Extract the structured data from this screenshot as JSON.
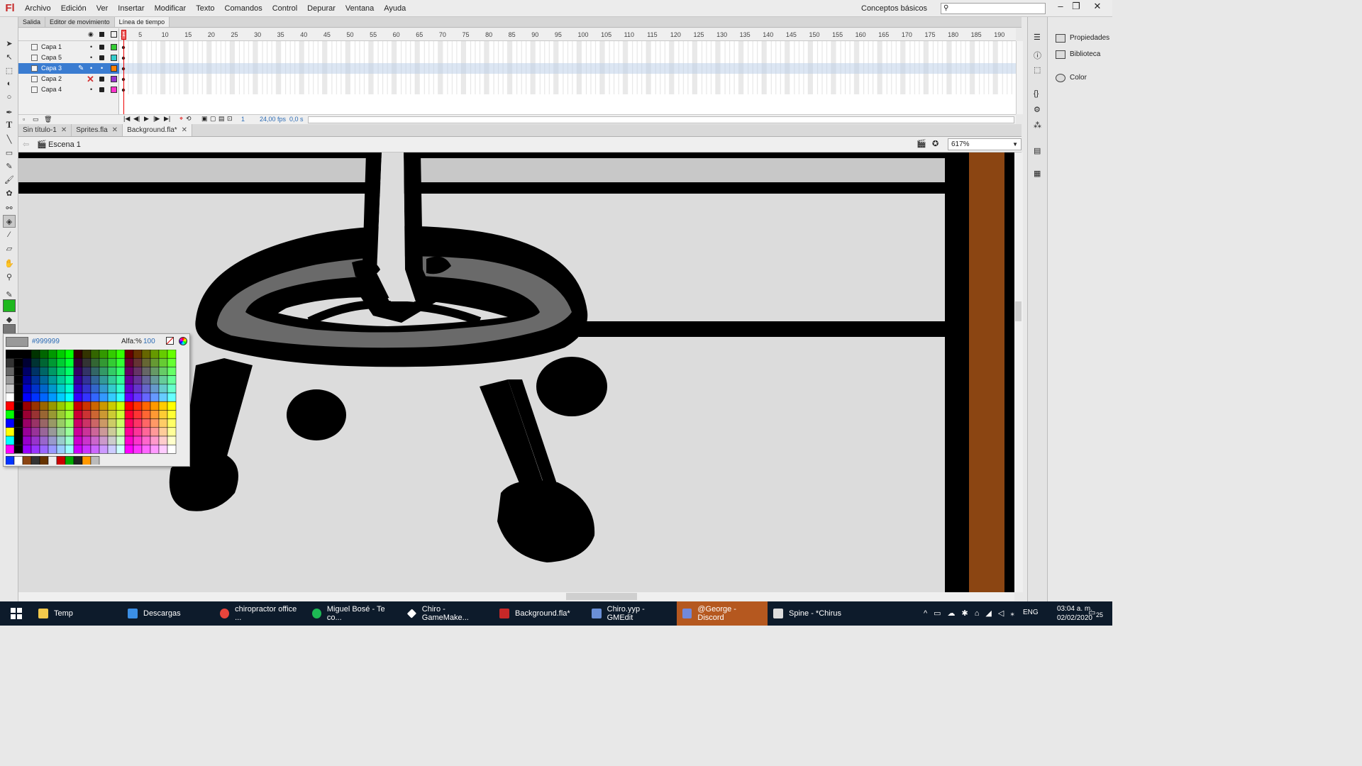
{
  "menubar": {
    "logo": "Fl",
    "items": [
      "Archivo",
      "Edición",
      "Ver",
      "Insertar",
      "Modificar",
      "Texto",
      "Comandos",
      "Control",
      "Depurar",
      "Ventana",
      "Ayuda"
    ],
    "workspace": "Conceptos básicos",
    "search_placeholder": ""
  },
  "timeline": {
    "tabs": [
      "Salida",
      "Editor de movimiento",
      "Línea de tiempo"
    ],
    "layers": [
      {
        "name": "Capa 1",
        "color": "#33cc33"
      },
      {
        "name": "Capa 5",
        "color": "#33cccc"
      },
      {
        "name": "Capa 3",
        "color": "#ff8000"
      },
      {
        "name": "Capa 2",
        "color": "#9933cc"
      },
      {
        "name": "Capa 4",
        "color": "#ff33cc"
      }
    ],
    "ruler_ticks": [
      "1",
      "5",
      "10",
      "15",
      "20",
      "25",
      "30",
      "35",
      "40",
      "45",
      "50",
      "55",
      "60",
      "65",
      "70",
      "75",
      "80",
      "85",
      "90",
      "95",
      "100",
      "105",
      "110",
      "115",
      "120",
      "125",
      "130",
      "135",
      "140",
      "145",
      "150",
      "155",
      "160",
      "165",
      "170",
      "175",
      "180",
      "185",
      "190"
    ],
    "frame": "1",
    "fps": "24,00 fps",
    "time": "0,0 s"
  },
  "documents": {
    "tabs": [
      "Sin título-1",
      "Sprites.fla",
      "Background.fla*"
    ],
    "scene": "Escena 1",
    "zoom": "617%"
  },
  "right_panel": {
    "items": [
      "Propiedades",
      "Biblioteca",
      "Color"
    ]
  },
  "swatches": {
    "hex": "#999999",
    "alpha_label": "Alfa:%",
    "alpha_value": "100"
  },
  "taskbar": {
    "items": [
      {
        "label": "Temp",
        "color": "#f2c94c"
      },
      {
        "label": "Descargas",
        "color": "#3b8fe5"
      },
      {
        "label": "chiropractor office ...",
        "color": "#e8453c"
      },
      {
        "label": "Miguel Bosé - Te co...",
        "color": "#1db954"
      },
      {
        "label": "Chiro - GameMake...",
        "color": "#ffffff"
      },
      {
        "label": "Background.fla*",
        "color": "#c62828"
      },
      {
        "label": "Chiro.yyp - GMEdit",
        "color": "#6a8fd6"
      },
      {
        "label": "@George - Discord",
        "color": "#7289da"
      },
      {
        "label": "Spine - *Chirus",
        "color": "#dddddd"
      }
    ],
    "lang": "ENG",
    "time": "03:04 a. m.",
    "date": "02/02/2020",
    "notifications": "25"
  }
}
